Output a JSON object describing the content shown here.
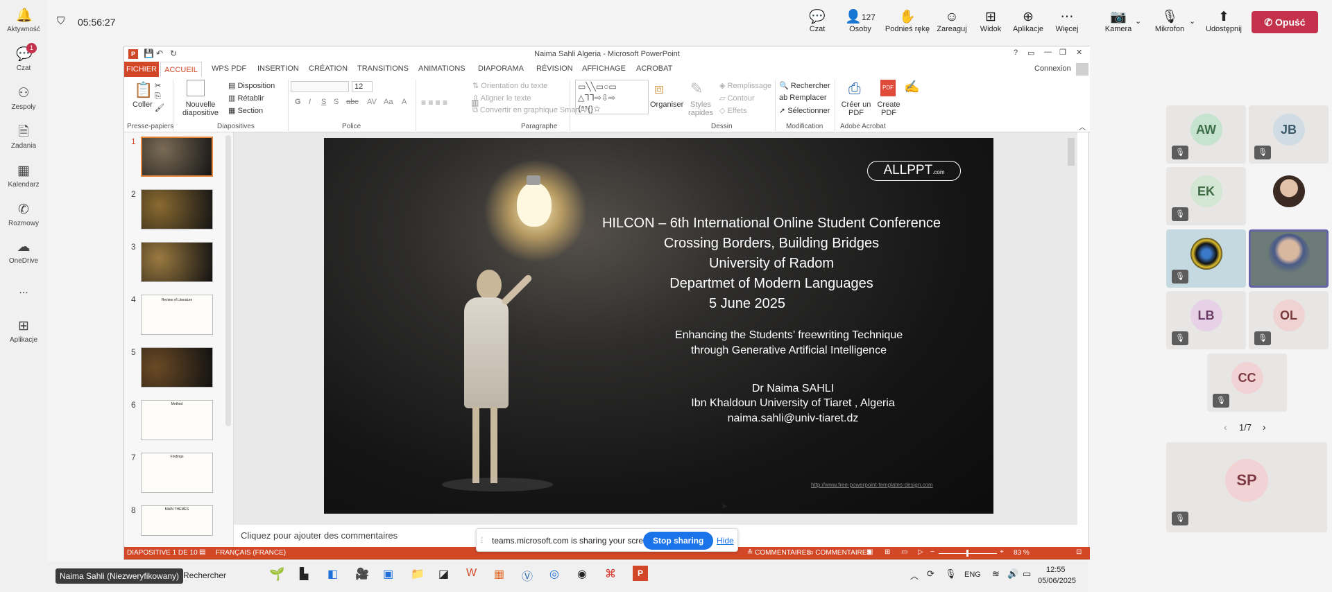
{
  "rail": [
    {
      "label": "Aktywność",
      "icon": "bell-icon"
    },
    {
      "label": "Czat",
      "icon": "chat-icon",
      "badge": "1"
    },
    {
      "label": "Zespoły",
      "icon": "teams-icon"
    },
    {
      "label": "Zadania",
      "icon": "tasks-icon"
    },
    {
      "label": "Kalendarz",
      "icon": "calendar-icon"
    },
    {
      "label": "Rozmowy",
      "icon": "phone-icon"
    },
    {
      "label": "OneDrive",
      "icon": "cloud-icon"
    },
    {
      "label": "...",
      "icon": "more-icon"
    },
    {
      "label": "Aplikacje",
      "icon": "apps-icon"
    }
  ],
  "topbar": {
    "timer": "05:56:27",
    "buttons": [
      {
        "label": "Czat",
        "icon": "chat-icon",
        "glyph": "💬"
      },
      {
        "label": "Osoby",
        "icon": "people-icon",
        "glyph": "👤",
        "count": "127"
      },
      {
        "label": "Podnieś rękę",
        "icon": "hand-icon",
        "glyph": "✋"
      },
      {
        "label": "Zareaguj",
        "icon": "smile-icon",
        "glyph": "☺"
      },
      {
        "label": "Widok",
        "icon": "grid-icon",
        "glyph": "⊞"
      },
      {
        "label": "Aplikacje",
        "icon": "add-icon",
        "glyph": "⊕"
      },
      {
        "label": "Więcej",
        "icon": "more-icon",
        "glyph": "⋯"
      },
      {
        "label": "Kamera",
        "icon": "camera-off-icon",
        "glyph": "📷"
      },
      {
        "label": "Mikrofon",
        "icon": "mic-off-icon",
        "glyph": "🎙"
      },
      {
        "label": "Udostępnij",
        "icon": "share-icon",
        "glyph": "⬆"
      }
    ],
    "leave": "Opuść"
  },
  "ppt": {
    "title": "Naima Sahli Algeria - Microsoft PowerPoint",
    "connexion": "Connexion",
    "tabs": [
      "FICHIER",
      "ACCUEIL",
      "WPS PDF",
      "INSERTION",
      "CRÉATION",
      "TRANSITIONS",
      "ANIMATIONS",
      "DIAPORAMA",
      "RÉVISION",
      "AFFICHAGE",
      "ACROBAT"
    ],
    "ribbon": {
      "coller": "Coller",
      "nouvelle": "Nouvelle diapositive",
      "disposition": "Disposition",
      "retablir": "Rétablir",
      "section": "Section",
      "font_size": "12",
      "orientation": "Orientation du texte",
      "aligner": "Aligner le texte",
      "convertir": "Convertir en graphique SmartArt",
      "organiser": "Organiser",
      "styles": "Styles rapides",
      "remplissage": "Remplissage",
      "contour": "Contour",
      "effets": "Effets",
      "rechercher": "Rechercher",
      "remplacer": "Remplacer",
      "selectionner": "Sélectionner",
      "creer_pdf": "Créer un PDF",
      "create_pdf": "Create PDF",
      "groups": [
        "Presse-papiers",
        "Diapositives",
        "Police",
        "Paragraphe",
        "Dessin",
        "Modification",
        "Adobe Acrobat"
      ]
    },
    "thumb_numbers": [
      "1",
      "2",
      "3",
      "4",
      "5",
      "6",
      "7",
      "8"
    ],
    "thumb_texts": [
      "",
      "",
      "",
      "Review of Literature",
      "",
      "Method",
      "Findings",
      "MAIN THEMES"
    ],
    "slide": {
      "logo": "ALLPPT",
      "logo_small": ".com",
      "lines": [
        "HILCON – 6th International Online Student Conference",
        "Crossing Borders, Building Bridges",
        "University of Radom",
        "Departmet of Modern Languages",
        "5 June 2025"
      ],
      "subtitle1": "Enhancing the Students’ freewriting Technique",
      "subtitle2": "through Generative Artificial Intelligence",
      "author": "Dr Naima SAHLI",
      "univ": "Ibn Khaldoun University of Tiaret , Algeria",
      "email": "naima.sahli@univ-tiaret.dz",
      "url": "http://www.free-powerpoint-templates-design.com"
    },
    "notes": "Cliquez pour ajouter des commentaires",
    "status": {
      "slide": "DIAPOSITIVE 1 DE 10",
      "lang": "FRANÇAIS (FRANCE)",
      "comments1": "COMMENTAIRES",
      "comments2": "COMMENTAIRES",
      "zoom": "83 %"
    }
  },
  "sharebar": {
    "text": "teams.microsoft.com is sharing your screen.",
    "stop": "Stop sharing",
    "hide": "Hide"
  },
  "participants": [
    {
      "initials": "AW",
      "color": "#c6e3d0",
      "text": "#3c6e4a"
    },
    {
      "initials": "JB",
      "color": "#cfdce3",
      "text": "#3d5a6b"
    },
    {
      "initials": "EK",
      "color": "#d3e6d4",
      "text": "#3e6a44"
    },
    {
      "initials": "",
      "color": "#f5f5f5",
      "text": "#333",
      "photo": true
    },
    {
      "initials": "",
      "color": "#1b1b1b",
      "text": "#fff",
      "photo": true
    },
    {
      "initials": "",
      "color": "#5e6d6d",
      "text": "#fff",
      "photo": true,
      "active": true
    },
    {
      "initials": "LB",
      "color": "#e7d1e6",
      "text": "#6a3d66"
    },
    {
      "initials": "OL",
      "color": "#efd3d3",
      "text": "#7a3a3a"
    },
    {
      "initials": "CC",
      "color": "#f1d3d6",
      "text": "#7e3a44"
    }
  ],
  "pager": "1/7",
  "self": {
    "initials": "SP",
    "color": "#f1d3d6",
    "text": "#7e3a44"
  },
  "taskbar": {
    "search": "Rechercher",
    "lang": "ENG",
    "time": "12:55",
    "date": "05/06/2025",
    "caption": "Naima Sahli (Niezweryfikowany)"
  }
}
